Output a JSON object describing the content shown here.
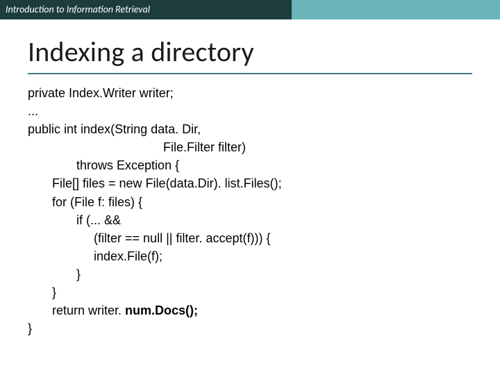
{
  "header": {
    "course": "Introduction to Information Retrieval"
  },
  "title": "Indexing a directory",
  "code": {
    "l1": "private Index.Writer writer;",
    "l2": "...",
    "l3": "public int index(String data. Dir,",
    "l4": "                                       File.Filter filter)",
    "l5": "              throws Exception {",
    "l6": "       File[] files = new File(data.Dir). list.Files();",
    "l7": "       for (File f: files) {",
    "l8": "              if (... &&",
    "l9": "                   (filter == null || filter. accept(f))) {",
    "l10a": "                   index.File(f);",
    "l11": "              }",
    "l12": "       }",
    "l13a": "       return writer. ",
    "l13b": "num.Docs();",
    "l14": "}"
  }
}
